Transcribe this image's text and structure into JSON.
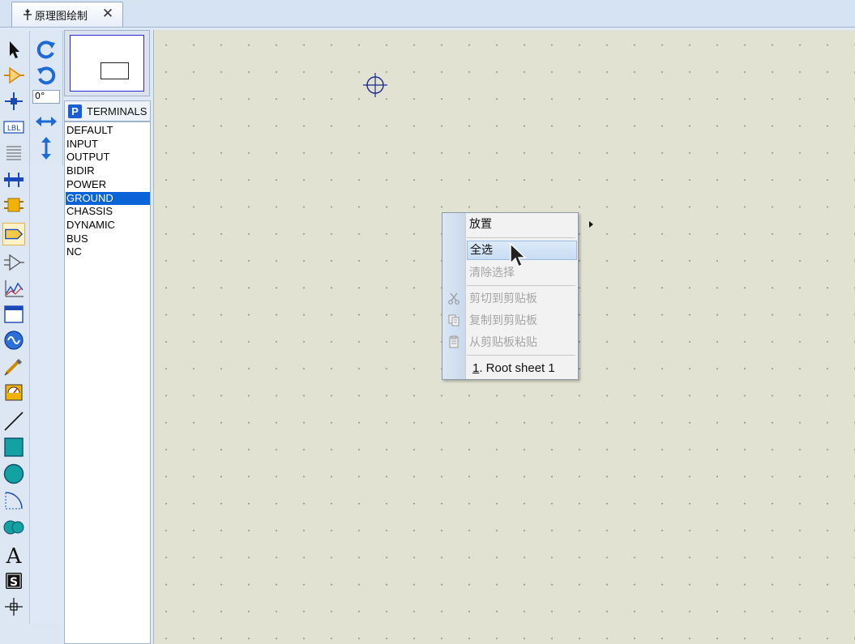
{
  "tab": {
    "title": "原理图绘制",
    "close_glyph": "✕",
    "icon": "schematic-icon"
  },
  "rotation": {
    "value": "0°"
  },
  "terminals": {
    "badge": "P",
    "header": "TERMINALS",
    "items": [
      "DEFAULT",
      "INPUT",
      "OUTPUT",
      "BIDIR",
      "POWER",
      "GROUND",
      "CHASSIS",
      "DYNAMIC",
      "BUS",
      "NC"
    ],
    "selected": "GROUND"
  },
  "context_menu": {
    "place": "放置",
    "select_all": "全选",
    "clear_selection": "清除选择",
    "cut": "剪切到剪贴板",
    "copy": "复制到剪贴板",
    "paste": "从剪贴板粘贴",
    "sheet_accel": "1",
    "sheet_label": ". Root sheet 1"
  },
  "colors": {
    "accent": "#0a64d8",
    "canvas": "#e2e2d3",
    "preview_border": "#2b2bd6"
  },
  "tools": [
    "selection-mode-icon",
    "component-mode-icon",
    "junction-dot-icon",
    "wire-label-icon",
    "text-script-icon",
    "bus-icon",
    "subcircuit-icon",
    "terminals-mode-icon",
    "device-pin-icon",
    "graph-icon",
    "tape-recorder-icon",
    "generator-icon",
    "voltage-probe-icon",
    "virtual-instrument-icon",
    "line-icon",
    "box-icon",
    "circle-icon",
    "arc-icon",
    "path-icon",
    "text-icon",
    "symbol-icon",
    "marker-icon"
  ]
}
